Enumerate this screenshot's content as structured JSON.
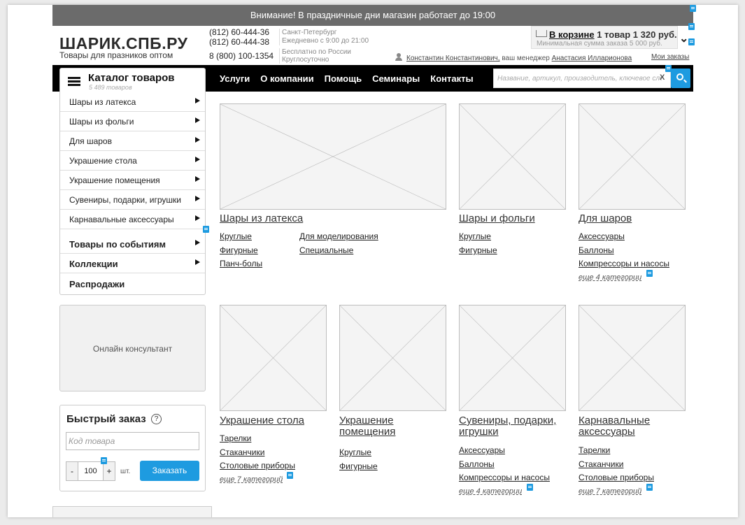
{
  "banner": "Внимание! В праздничные дни магазин работает до 19:00",
  "header": {
    "logo": "ШАРИК.СПБ.РУ",
    "tagline": "Товары для празников оптом",
    "phone1": "(812) 60-444-36",
    "phone2": "(812) 60-444-38",
    "phone3": "8 (800) 100-1354",
    "city": "Санкт-Петербург",
    "hours": "Ежедневно с 9:00 до 21:00",
    "free1": "Бесплатно по России",
    "free2": "Круглосуточно",
    "cart_link": "В корзине",
    "cart_summary": "1 товар 1 320 руб.",
    "cart_min": "Минимальная сумма заказа 5 000 руб.",
    "manager_user": "Константин Константинович,",
    "manager_text": "ваш менеджер",
    "manager_name": "Анастасия Илларионова",
    "my_orders": "Мои заказы"
  },
  "nav": {
    "catalog_title": "Каталог товаров",
    "catalog_count": "5 489 товаров",
    "links": [
      "Услуги",
      "О компании",
      "Помощь",
      "Семинары",
      "Контакты"
    ],
    "search_placeholder": "Название, артикул, производитель, ключевое слово",
    "search_clear": "X"
  },
  "menu": [
    "Шары из латекса",
    "Шары из фольги",
    "Для шаров",
    "Украшение стола",
    "Украшение помещения",
    "Сувениры, подарки, игрушки",
    "Карнавальные аксессуары",
    "Товары по событиям",
    "Коллекции",
    "Распродажи"
  ],
  "consultant": "Онлайн консультант",
  "quick_order": {
    "title": "Быстрый заказ",
    "help": "?",
    "code_placeholder": "Код товара",
    "minus": "-",
    "qty": "100",
    "plus": "+",
    "unit": "шт.",
    "button": "Заказать"
  },
  "cards": [
    {
      "title": "Шары из латекса",
      "links": [
        "Круглые",
        "Фигурные",
        "Панч-болы",
        "Для моделирования",
        "Специальные"
      ]
    },
    {
      "title": "Шары и фольги",
      "links": [
        "Круглые",
        "Фигурные"
      ]
    },
    {
      "title": "Для шаров",
      "links": [
        "Аксессуары",
        "Баллоны",
        "Компрессоры и насосы"
      ],
      "more": "еще 4 категории"
    },
    {
      "title": "Украшение стола",
      "links": [
        "Тарелки",
        "Стаканчики",
        "Столовые приборы"
      ],
      "more": "еще 7 категорий"
    },
    {
      "title": "Украшение помещения",
      "title_l1": "Украшение",
      "title_l2": "помещения",
      "links": [
        "Круглые",
        "Фигурные"
      ]
    },
    {
      "title": "Сувениры, подарки, игрушки",
      "title_l1": "Сувениры, подарки,",
      "title_l2": "игрушки",
      "links": [
        "Аксессуары",
        "Баллоны",
        "Компрессоры и насосы"
      ],
      "more": "еще 4 категории"
    },
    {
      "title": "Карнавальные аксессуары",
      "title_l1": "Карнавальные",
      "title_l2": "аксессуары",
      "links": [
        "Тарелки",
        "Стаканчики",
        "Столовые приборы"
      ],
      "more": "еще 7 категорий"
    }
  ],
  "colors": {
    "accent": "#1e9be0",
    "navbar": "#000000",
    "banner": "#6b6b6b"
  }
}
